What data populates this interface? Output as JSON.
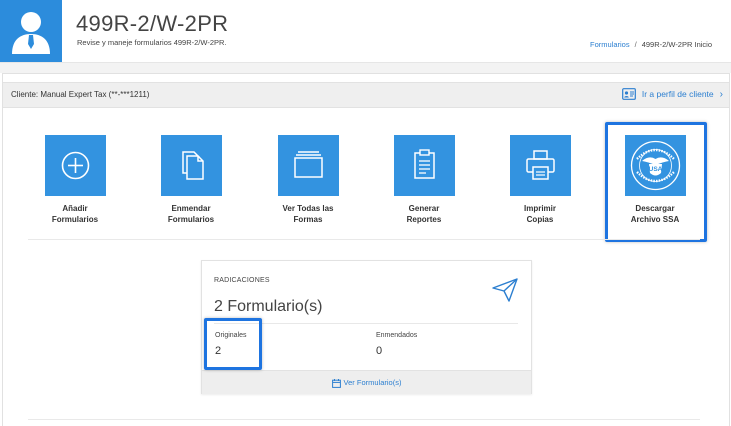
{
  "header": {
    "title": "499R-2/W-2PR",
    "subtitle": "Revise y maneje formularios 499R-2/W-2PR.",
    "breadcrumb": {
      "link": "Formularios",
      "separator": "/",
      "current": "499R-2/W-2PR Inicio"
    }
  },
  "client_bar": {
    "label": "Cliente: Manual Expert Tax (**-***1211)",
    "profile_link": "Ir a perfil de cliente"
  },
  "actions": [
    {
      "label": "Añadir\nFormularios",
      "icon": "plus-circle-icon"
    },
    {
      "label": "Enmendar\nFormularios",
      "icon": "documents-icon"
    },
    {
      "label": "Ver Todas las\nFormas",
      "icon": "folder-icon"
    },
    {
      "label": "Generar\nReportes",
      "icon": "clipboard-icon"
    },
    {
      "label": "Imprimir\nCopias",
      "icon": "printer-icon"
    },
    {
      "label": "Descargar\nArchivo SSA",
      "icon": "ssa-seal-icon",
      "seal_text": "USA"
    }
  ],
  "filings": {
    "heading": "RADICACIONES",
    "count": "2 Formulario(s)",
    "originals_label": "Originales",
    "originals_value": "2",
    "amended_label": "Enmendados",
    "amended_value": "0",
    "view_link": "Ver Formulario(s)"
  },
  "colors": {
    "accent": "#3393e0",
    "link": "#2c7fd0",
    "highlight": "#1e74e0"
  }
}
